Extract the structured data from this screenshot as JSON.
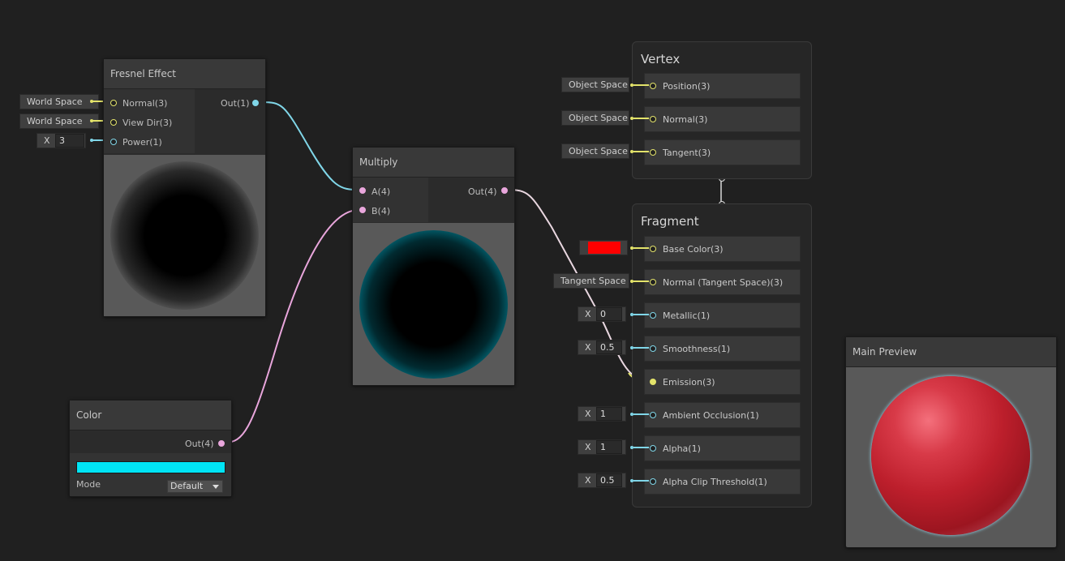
{
  "fresnel": {
    "title": "Fresnel Effect",
    "inputs": [
      {
        "label": "Normal(3)",
        "value": "World Space"
      },
      {
        "label": "View Dir(3)",
        "value": "World Space"
      },
      {
        "label": "Power(1)",
        "prefix": "X",
        "value": "3"
      }
    ],
    "output": "Out(1)"
  },
  "multiply": {
    "title": "Multiply",
    "inputs": [
      "A(4)",
      "B(4)"
    ],
    "output": "Out(4)"
  },
  "color_node": {
    "title": "Color",
    "output": "Out(4)",
    "swatch_color": "#00e5f5",
    "mode_label": "Mode",
    "mode_value": "Default"
  },
  "vertex": {
    "title": "Vertex",
    "blocks": [
      {
        "label": "Position(3)",
        "input": "Object Space"
      },
      {
        "label": "Normal(3)",
        "input": "Object Space"
      },
      {
        "label": "Tangent(3)",
        "input": "Object Space"
      }
    ]
  },
  "fragment": {
    "title": "Fragment",
    "blocks": [
      {
        "label": "Base Color(3)",
        "swatch": "#ff0000"
      },
      {
        "label": "Normal (Tangent Space)(3)",
        "input": "Tangent Space"
      },
      {
        "label": "Metallic(1)",
        "prefix": "X",
        "value": "0"
      },
      {
        "label": "Smoothness(1)",
        "prefix": "X",
        "value": "0.5"
      },
      {
        "label": "Emission(3)"
      },
      {
        "label": "Ambient Occlusion(1)",
        "prefix": "X",
        "value": "1"
      },
      {
        "label": "Alpha(1)",
        "prefix": "X",
        "value": "1"
      },
      {
        "label": "Alpha Clip Threshold(1)",
        "prefix": "X",
        "value": "0.5"
      }
    ]
  },
  "main_preview": {
    "title": "Main Preview"
  },
  "colors": {
    "vector3_port": "#e3e36a",
    "vector1_port": "#80d6e8",
    "vector4_port": "#e9a6dc",
    "background": "#202020"
  }
}
